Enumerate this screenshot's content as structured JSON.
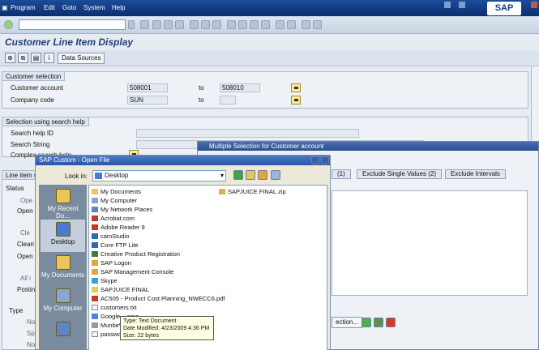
{
  "menu": [
    "Program",
    "Edit",
    "Goto",
    "System",
    "Help"
  ],
  "brand": "SAP",
  "title": "Customer Line Item Display",
  "app_toolbar": {
    "data_sources": "Data Sources",
    "info_icon": "i"
  },
  "customer_selection": {
    "header": "Customer selection",
    "rows": [
      {
        "label": "Customer account",
        "from": "508001",
        "to_label": "to",
        "to": "508010"
      },
      {
        "label": "Company code",
        "from": "SUN",
        "to_label": "to",
        "to": ""
      }
    ]
  },
  "search_help": {
    "header": "Selection using search help",
    "labels": [
      "Search help ID",
      "Search String",
      "Complex search help"
    ]
  },
  "line_items": {
    "header": "Line item s",
    "status": "Status",
    "left_labels": [
      "Ope",
      "Open",
      "Cle",
      "Cleari",
      "Open",
      "All i",
      "Postin"
    ],
    "type": "Type",
    "type_items": [
      "Nor",
      "Spe",
      "Not"
    ]
  },
  "multiple_selection": {
    "title": "Multiple Selection for Customer account",
    "tabs": [
      "(1)",
      "Exclude Single Values (2)",
      "Exclude Intervals"
    ],
    "button": "ection..."
  },
  "open_file": {
    "title": "SAP Custom - Open File",
    "look_in_label": "Look in:",
    "look_in_value": "Desktop",
    "places": [
      "My Recent Do...",
      "Desktop",
      "My Documents",
      "My Computer",
      ""
    ],
    "files_col1": [
      "My Documents",
      "My Computer",
      "My Network Places",
      "Acrobat.com",
      "Adobe Reader 9",
      "camStudio",
      "Core FTP Lite",
      "Creative Product Registration",
      "SAP Logon",
      "SAP Management Console",
      "Skype",
      "SAPJUICE FINAL",
      "AC505 - Product Cost Planning_NWECC6.pdf",
      "customers.txt",
      "Google ...ome",
      "MunbeW...",
      "passwo..."
    ],
    "files_col2": [
      "SAPJUICE FINAL.zip"
    ]
  },
  "tooltip": {
    "type": "Type: Text Document",
    "modified": "Date Modified: 4/23/2009 4:36 PM",
    "size": "Size: 22 bytes"
  }
}
